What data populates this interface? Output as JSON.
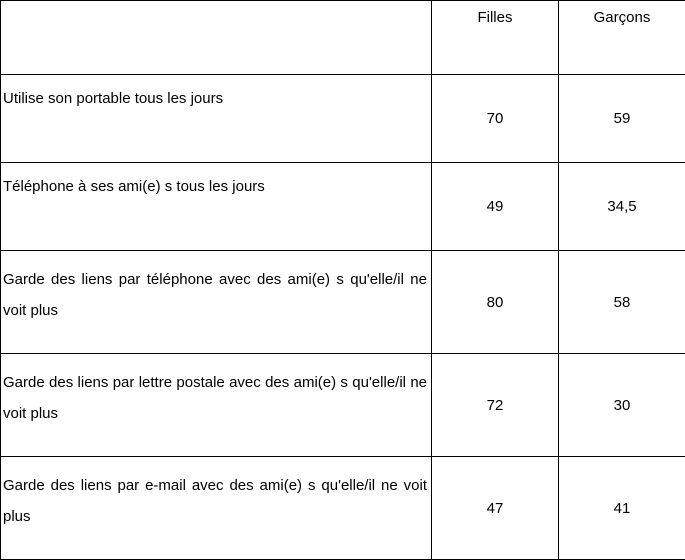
{
  "chart_data": {
    "type": "table",
    "columns": [
      "",
      "Filles",
      "Garçons"
    ],
    "rows": [
      {
        "label": "Utilise son portable tous les jours",
        "filles": "70",
        "garcons": "59"
      },
      {
        "label": "Téléphone à ses ami(e) s tous les jours",
        "filles": "49",
        "garcons": "34,5"
      },
      {
        "label": "Garde des liens par téléphone avec des ami(e) s qu'elle/il ne voit plus",
        "filles": "80",
        "garcons": "58"
      },
      {
        "label": "Garde des liens par lettre postale avec des ami(e) s qu'elle/il ne voit plus",
        "filles": "72",
        "garcons": "30"
      },
      {
        "label": "Garde des liens par e-mail avec des ami(e) s qu'elle/il ne voit plus",
        "filles": "47",
        "garcons": "41"
      }
    ]
  }
}
